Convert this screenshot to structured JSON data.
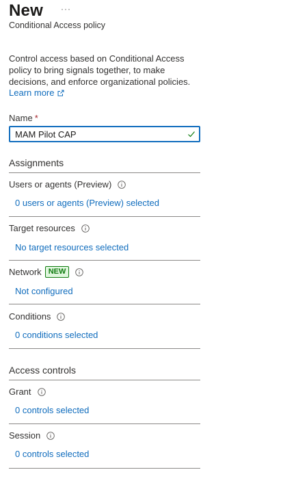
{
  "header": {
    "title": "New",
    "more": "···",
    "subtitle": "Conditional Access policy"
  },
  "intro": {
    "description": "Control access based on Conditional Access policy to bring signals together, to make decisions, and enforce organizational policies.",
    "learn_more": "Learn more"
  },
  "name_field": {
    "label": "Name",
    "required_marker": "*",
    "value": "MAM Pilot CAP"
  },
  "assignments": {
    "heading": "Assignments",
    "items": [
      {
        "label": "Users or agents (Preview)",
        "value": "0 users or agents (Preview) selected"
      },
      {
        "label": "Target resources",
        "value": "No target resources selected"
      },
      {
        "label": "Network",
        "badge": "NEW",
        "value": "Not configured"
      },
      {
        "label": "Conditions",
        "value": "0 conditions selected"
      }
    ]
  },
  "access_controls": {
    "heading": "Access controls",
    "items": [
      {
        "label": "Grant",
        "value": "0 controls selected"
      },
      {
        "label": "Session",
        "value": "0 controls selected"
      }
    ]
  },
  "colors": {
    "link": "#0f6cbd",
    "badge_green": "#107c10",
    "required_red": "#a4262c"
  }
}
